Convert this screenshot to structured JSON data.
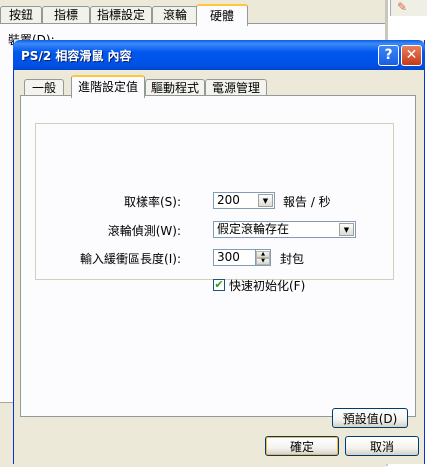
{
  "parent_window": {
    "tabs": [
      "按鈕",
      "指標",
      "指標設定",
      "滾輪",
      "硬體"
    ],
    "active_tab": 4,
    "devices_label": "裝置(D):"
  },
  "dialog": {
    "title": "PS/2 相容滑鼠 內容",
    "help_button": "?",
    "close_button": "✕",
    "tabs": [
      "一般",
      "進階設定值",
      "驅動程式",
      "電源管理"
    ],
    "active_tab": 1,
    "settings": {
      "sample_rate": {
        "label": "取樣率(S):",
        "value": "200",
        "unit": "報告 / 秒"
      },
      "wheel_detection": {
        "label": "滾輪偵測(W):",
        "value": "假定滾輪存在"
      },
      "input_buffer_length": {
        "label": "輸入緩衝區長度(I):",
        "value": "300",
        "unit": "封包"
      },
      "fast_init": {
        "label": "快速初始化(F)",
        "checked": true
      }
    },
    "defaults_button": "預設值(D)",
    "ok_button": "確定",
    "cancel_button": "取消"
  },
  "icons": {
    "check": "✔",
    "arrow_down": "▼",
    "arrow_up": "▲"
  }
}
